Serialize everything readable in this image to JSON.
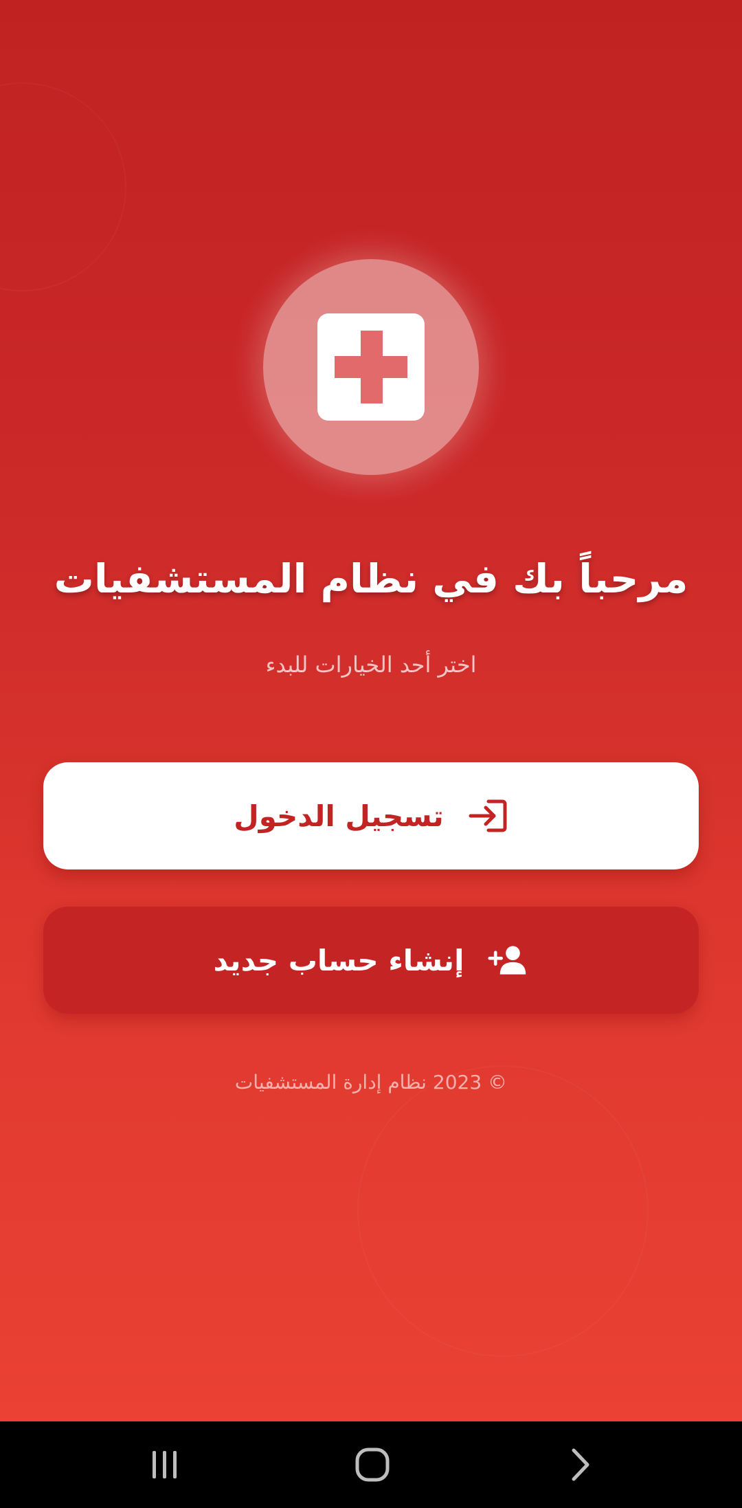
{
  "welcome": {
    "title": "مرحباً بك في نظام المستشفيات",
    "subtitle": "اختر أحد الخيارات للبدء"
  },
  "logo": {
    "icon": "medical-cross-icon"
  },
  "actions": {
    "login_label": "تسجيل الدخول",
    "login_icon": "login-arrow-icon",
    "register_label": "إنشاء حساب جديد",
    "register_icon": "add-user-icon"
  },
  "footer": {
    "copyright": "© 2023 نظام إدارة المستشفيات"
  },
  "navbar": {
    "recents_icon": "recents-icon",
    "home_icon": "home-icon",
    "back_icon": "back-icon"
  },
  "colors": {
    "primary": "#c22323",
    "button_secondary": "#c52425",
    "background_top": "#c02222",
    "background_bottom": "#ea4134"
  }
}
